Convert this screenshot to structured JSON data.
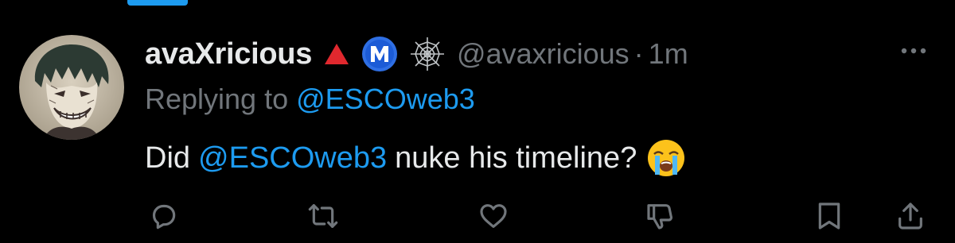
{
  "tweet": {
    "display_name": "avaXricious",
    "handle": "@avaxricious",
    "separator": "·",
    "time": "1m",
    "reply_prefix": "Replying to",
    "reply_handle": "@ESCOweb3",
    "text_before": "Did",
    "text_mention": "@ESCOweb3",
    "text_after": "nuke his timeline?",
    "badges": [
      "red-triangle-icon",
      "blue-m-circle-icon",
      "spider-web-icon"
    ],
    "emoji": "loudly-crying-face-icon"
  },
  "actions": [
    "reply-icon",
    "retweet-icon",
    "like-icon",
    "downvote-icon",
    "bookmark-icon",
    "share-icon"
  ],
  "colors": {
    "background": "#000000",
    "text": "#e7e9ea",
    "muted": "#71767b",
    "accent": "#1d9bf0",
    "badge_red": "#e0282e"
  }
}
